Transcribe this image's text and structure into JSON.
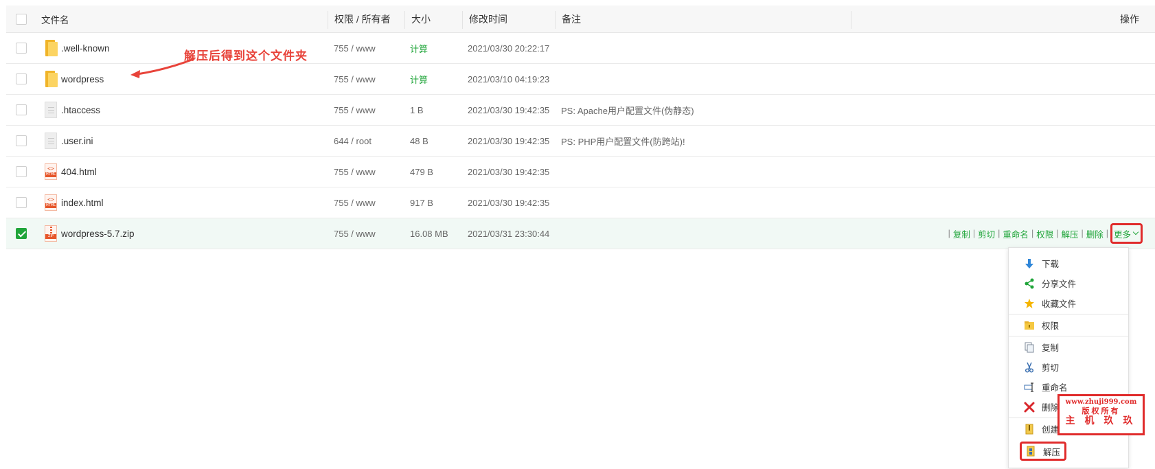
{
  "table": {
    "headers": {
      "name": "文件名",
      "perm": "权限 / 所有者",
      "size": "大小",
      "mtime": "修改时间",
      "note": "备注",
      "ops": "操作"
    },
    "rows": [
      {
        "name": ".well-known",
        "icon": "folder-icon",
        "perm": "755 / www",
        "size": "计算",
        "mtime": "2021/03/30 20:22:17",
        "note": ""
      },
      {
        "name": "wordpress",
        "icon": "folder-icon",
        "perm": "755 / www",
        "size": "计算",
        "mtime": "2021/03/10 04:19:23",
        "note": ""
      },
      {
        "name": ".htaccess",
        "icon": "document-icon",
        "perm": "755 / www",
        "size": "1 B",
        "mtime": "2021/03/30 19:42:35",
        "note": "PS: Apache用户配置文件(伪静态)"
      },
      {
        "name": ".user.ini",
        "icon": "document-icon",
        "perm": "644 / root",
        "size": "48 B",
        "mtime": "2021/03/30 19:42:35",
        "note": "PS: PHP用户配置文件(防跨站)!"
      },
      {
        "name": "404.html",
        "icon": "html-file-icon",
        "perm": "755 / www",
        "size": "479 B",
        "mtime": "2021/03/30 19:42:35",
        "note": ""
      },
      {
        "name": "index.html",
        "icon": "html-file-icon",
        "perm": "755 / www",
        "size": "917 B",
        "mtime": "2021/03/30 19:42:35",
        "note": ""
      },
      {
        "name": "wordpress-5.7.zip",
        "icon": "zip-file-icon",
        "perm": "755 / www",
        "size": "16.08 MB",
        "mtime": "2021/03/31 23:30:44",
        "note": "",
        "selected": true
      }
    ],
    "icon_labels": {
      "html": "HTML",
      "zip": "ZIP",
      "code": "<>"
    }
  },
  "row_ops": {
    "copy": "复制",
    "cut": "剪切",
    "rename": "重命名",
    "perm": "权限",
    "extract": "解压",
    "delete": "删除",
    "more": "更多",
    "sep": "|"
  },
  "menu": {
    "download": "下载",
    "share": "分享文件",
    "favorite": "收藏文件",
    "permission": "权限",
    "copy": "复制",
    "cut": "剪切",
    "rename": "重命名",
    "delete": "删除",
    "compress": "创建压缩",
    "extract": "解压"
  },
  "annotation": {
    "text": "解压后得到这个文件夹",
    "color": "#e8433a"
  },
  "watermark": {
    "line1": "www.zhuji999.com",
    "line2": "版权所有",
    "line3": "主机玖玖"
  },
  "colors": {
    "accent": "#20a53a",
    "highlight": "#e02b2b"
  }
}
